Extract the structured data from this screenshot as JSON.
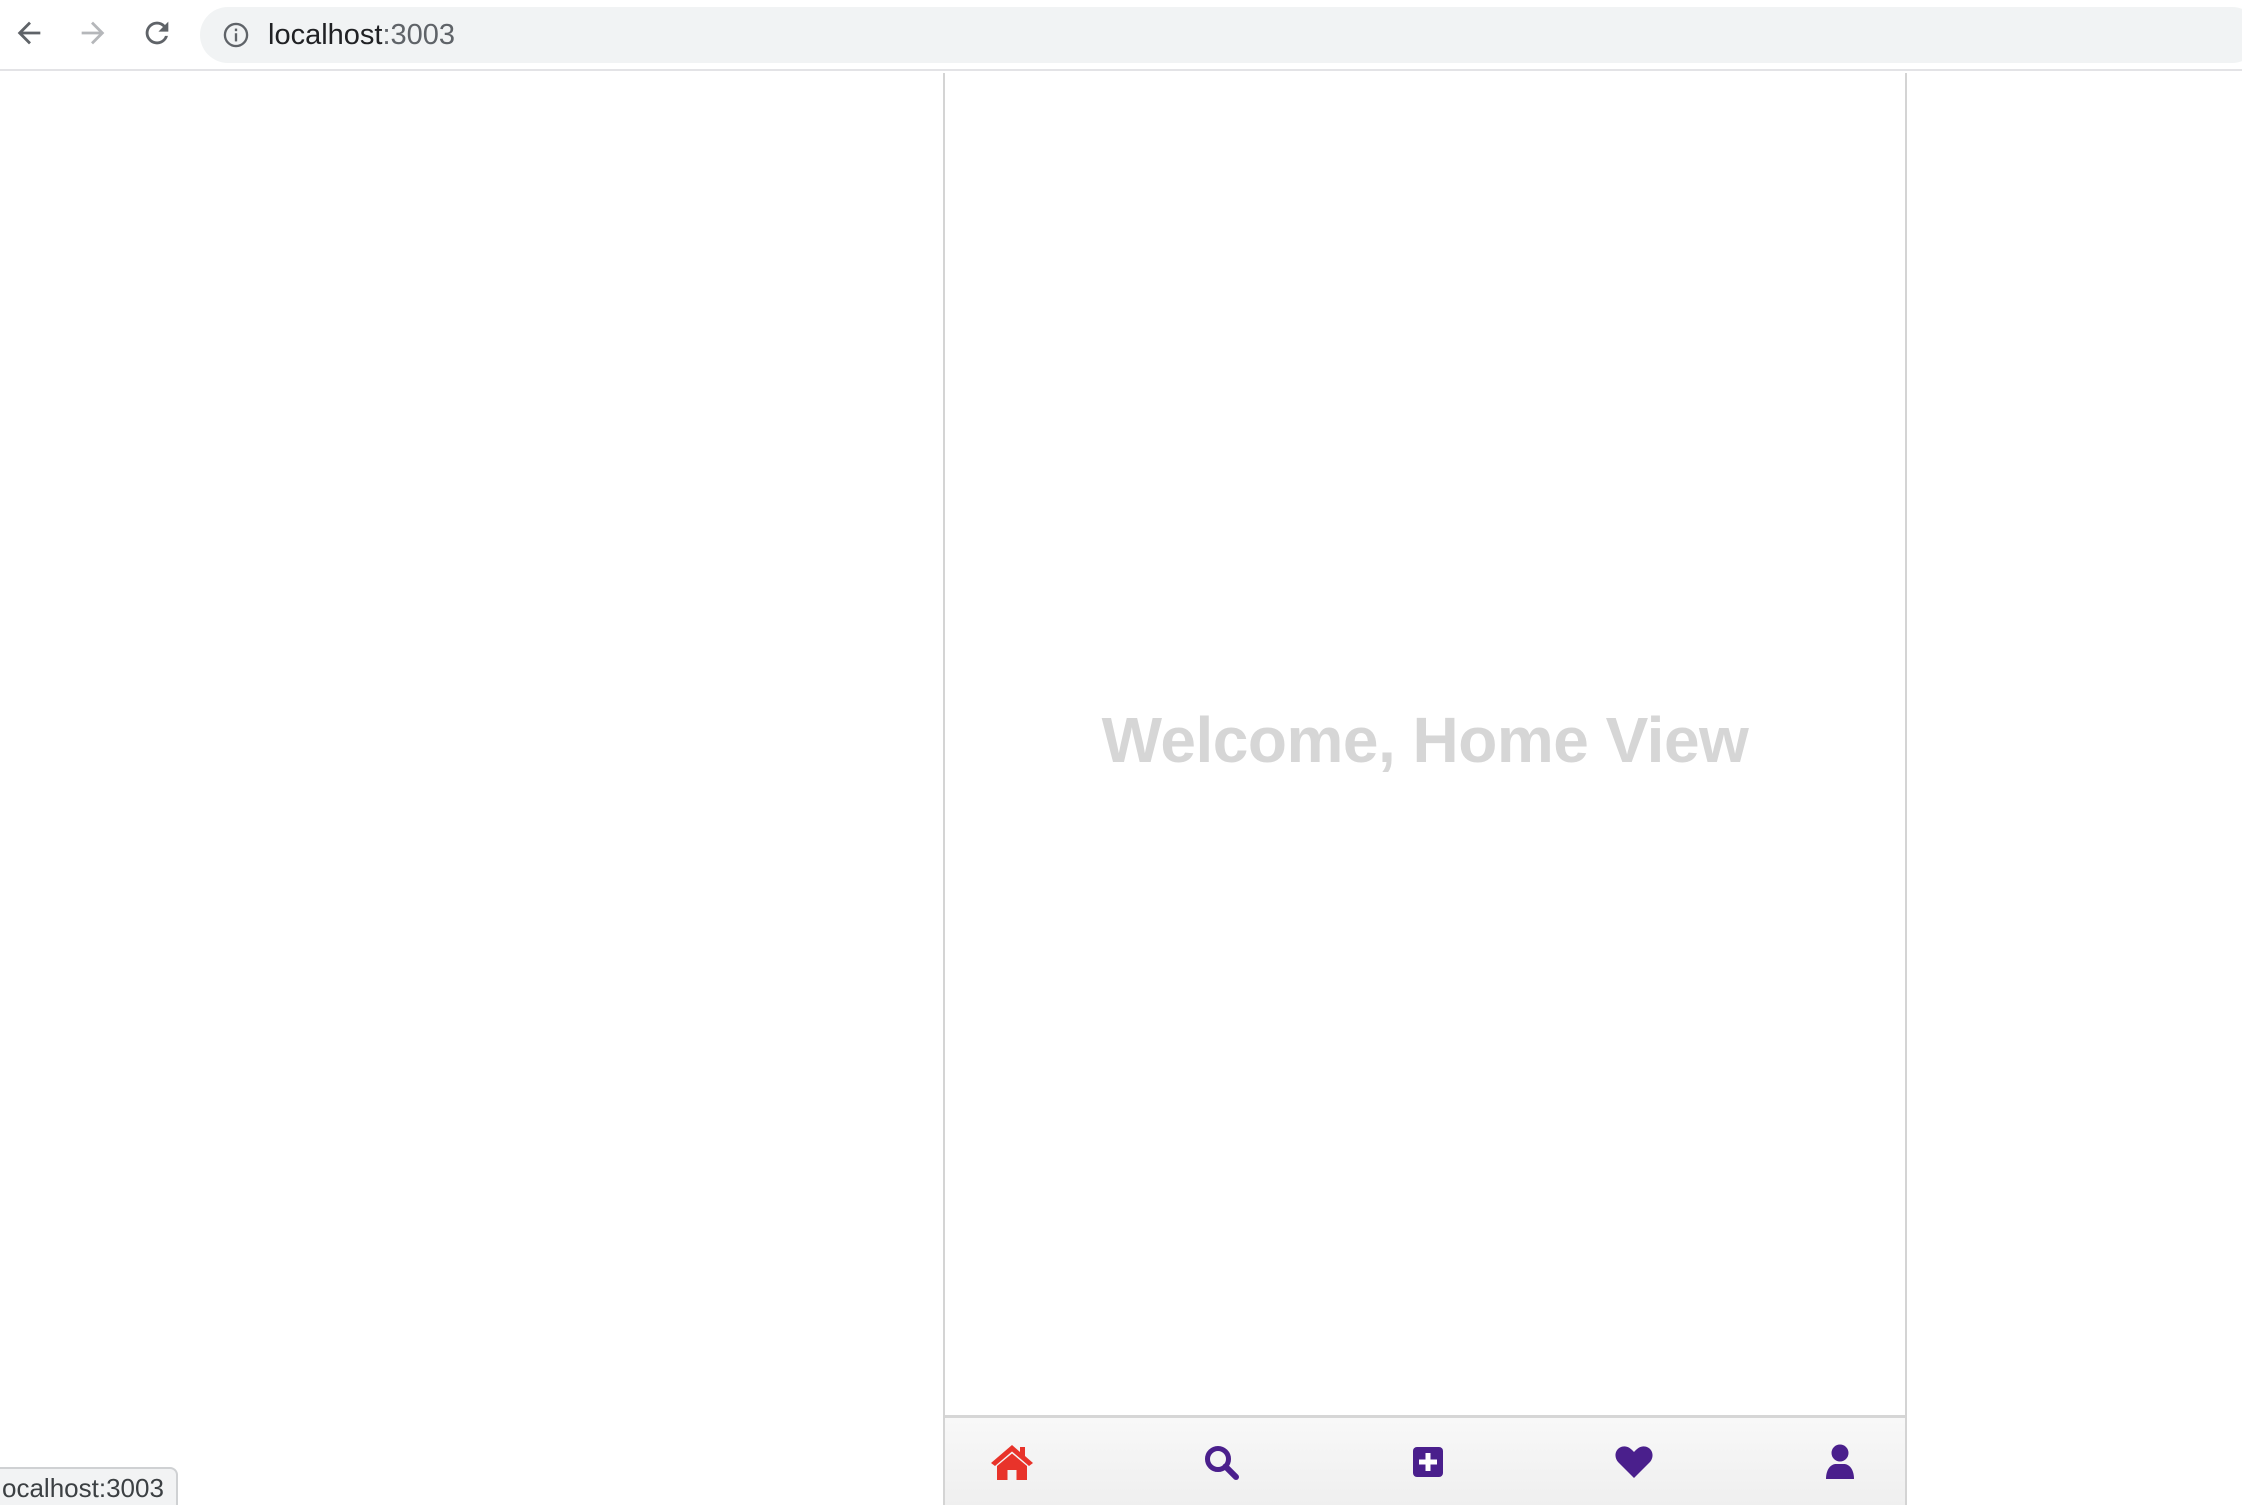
{
  "browser": {
    "url_host": "localhost",
    "url_port": ":3003",
    "back_icon": "arrow-left-icon",
    "forward_icon": "arrow-right-icon",
    "reload_icon": "reload-icon",
    "info_icon": "info-icon"
  },
  "main": {
    "welcome_text": "Welcome, Home View"
  },
  "bottom_nav": {
    "items": [
      {
        "name": "home",
        "icon": "home-icon",
        "color": "#e8332a",
        "active": true
      },
      {
        "name": "search",
        "icon": "search-icon",
        "color": "#4a1f8c",
        "active": false
      },
      {
        "name": "add",
        "icon": "plus-square-icon",
        "color": "#4a1f8c",
        "active": false
      },
      {
        "name": "favorites",
        "icon": "heart-icon",
        "color": "#4a1f8c",
        "active": false
      },
      {
        "name": "profile",
        "icon": "user-icon",
        "color": "#4a1f8c",
        "active": false
      }
    ]
  },
  "status_bar": {
    "text": "ocalhost:3003"
  }
}
